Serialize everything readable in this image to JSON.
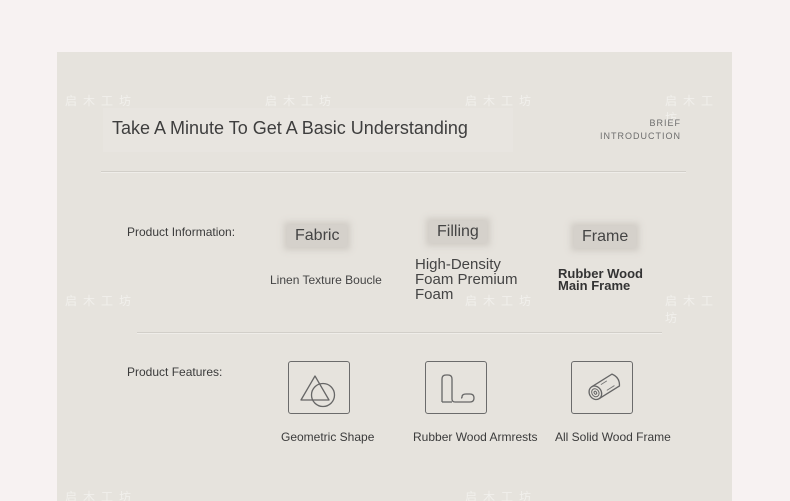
{
  "header": {
    "title": "Take A Minute To Get A Basic Understanding",
    "brief_line1": "BRIEF",
    "brief_line2": "INTRODUCTION"
  },
  "watermark": "启木工坊",
  "product_information": {
    "label": "Product Information:",
    "items": [
      {
        "tag": "Fabric",
        "value": "Linen Texture Boucle"
      },
      {
        "tag": "Filling",
        "value": "High-Density Foam Premium Foam"
      },
      {
        "tag": "Frame",
        "value": "Rubber Wood Main Frame"
      }
    ]
  },
  "product_features": {
    "label": "Product Features:",
    "items": [
      {
        "icon": "geometric-shape-icon",
        "label": "Geometric Shape"
      },
      {
        "icon": "armrest-icon",
        "label": "Rubber Wood Armrests"
      },
      {
        "icon": "wood-log-icon",
        "label": "All Solid Wood Frame"
      }
    ]
  },
  "colors": {
    "page_background": "#f7f2f2",
    "card_background": "#e6e3dd",
    "tag_background": "#d5d1cb",
    "text": "#3e3e3e"
  }
}
